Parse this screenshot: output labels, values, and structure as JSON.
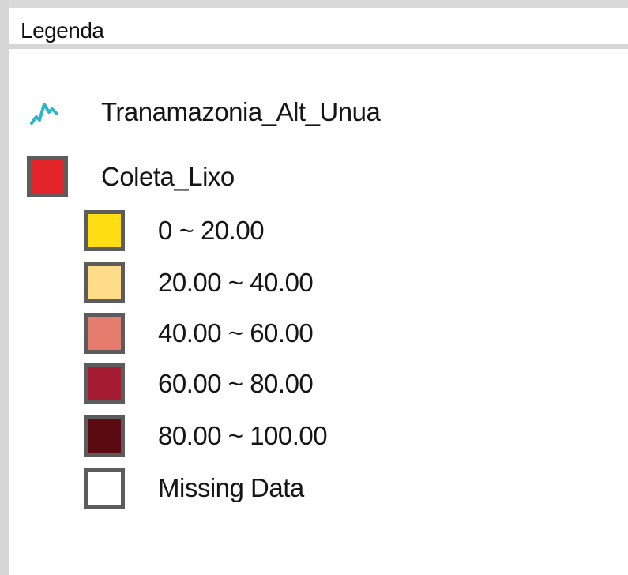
{
  "header": {
    "title": "Legenda"
  },
  "layers": [
    {
      "label": "Tranamazonia_Alt_Unua",
      "icon": "line-icon",
      "color": "#2bb6c9"
    },
    {
      "label": "Coleta_Lixo",
      "icon": "fill-swatch-icon",
      "color": "#e3242b"
    }
  ],
  "classes": [
    {
      "label": "0 ~ 20.00",
      "color": "#ffdd12"
    },
    {
      "label": "20.00 ~ 40.00",
      "color": "#ffdc87"
    },
    {
      "label": "40.00 ~ 60.00",
      "color": "#e57c6e"
    },
    {
      "label": "60.00 ~ 80.00",
      "color": "#a51c32"
    },
    {
      "label": "80.00 ~ 100.00",
      "color": "#5c0b12"
    },
    {
      "label": "Missing Data",
      "color": "#ffffff"
    }
  ]
}
